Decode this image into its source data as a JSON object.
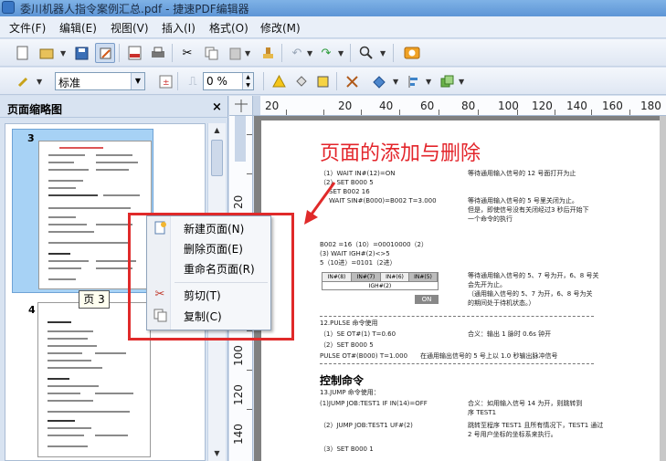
{
  "window": {
    "title": "委川机器人指令案例汇总.pdf - 捷速PDF编辑器"
  },
  "menubar": {
    "items": [
      {
        "label": "文件(F)"
      },
      {
        "label": "编辑(E)"
      },
      {
        "label": "视图(V)"
      },
      {
        "label": "插入(I)"
      },
      {
        "label": "格式(O)"
      },
      {
        "label": "修改(M)"
      }
    ]
  },
  "toolbar2": {
    "style_combo_value": "标准",
    "opacity_value": "0 %"
  },
  "left_panel": {
    "title": "页面缩略图",
    "close_glyph": "×",
    "pages": [
      {
        "number": "3"
      },
      {
        "number": "4"
      }
    ],
    "tooltip": "页 3"
  },
  "rulers": {
    "horizontal_labels": [
      "20",
      "20",
      "40",
      "60",
      "80",
      "100",
      "120",
      "140",
      "160",
      "180"
    ],
    "vertical_labels": [
      "20",
      "40",
      "60",
      "80",
      "100",
      "120",
      "140"
    ]
  },
  "document": {
    "heading": "页面的添加与删除",
    "lines": [
      "（1）WAIT IN#(12)=ON",
      "（2）SET B000 5",
      "SET B002 16",
      "WAIT SIN#(B000)=B002 T=3.000",
      "等待通用输入信号的 12 号面打开为止",
      "等待通用输入信号的 5 号里关闭为止。",
      "但是，即使信号没有关闭经过3 秒后开始下",
      "一个命令的执行",
      "B002 =16（10）=00010000（2）",
      "(3) WAIT IGH#(2)<>5",
      "5（10进）=0101（2进）",
      "等待通用输入信号的 5、7 号为开，6、8 号关",
      "会先开为止。",
      "（通用输入信号的 5、7 为开，6、8 号为关",
      "的期间处于待机状态。）",
      "12.PULSE 命令使用",
      "（1）SE OT#(1)      T=0.60",
      "（2）SET B000 5",
      "PULSE OT#(B000) T=1.000",
      "合义：输出 1 脉时 0.6s 钟开",
      "在通用输出信号的 5 号上以 1.0 秒输出脉冲信号",
      "13.JUMP 命令使用：",
      "(1)JUMP JOB:TEST1 IF IN(14)=OFF",
      "合义：如用输入信号 14 为开，则跳转到",
      "序 TEST1",
      "（2）JUMP JOB:TEST1 UF#(2)",
      "跳转至程序 TEST1 且所有情况下，TEST1 通过",
      "2 号用户坐标的坐标系来执行。",
      "（3）SET B000 1"
    ],
    "table_cells": [
      "IN#(8)",
      "IN#(7)",
      "IN#(6)",
      "IN#(5)"
    ],
    "table_row2": "IGH#(2)",
    "on_button": "ON",
    "bold_heading": "控制命令"
  },
  "context_menu": {
    "items": [
      {
        "label": "新建页面(N)",
        "icon": "new-page-icon"
      },
      {
        "label": "删除页面(E)",
        "icon": ""
      },
      {
        "label": "重命名页面(R)",
        "icon": ""
      },
      {
        "label": "剪切(T)",
        "icon": "scissors-icon"
      },
      {
        "label": "复制(C)",
        "icon": "copy-icon"
      }
    ]
  },
  "colors": {
    "heading_red": "#e3252b",
    "annotation_red": "#e02a2a",
    "selection_blue": "#a7d2f5"
  }
}
